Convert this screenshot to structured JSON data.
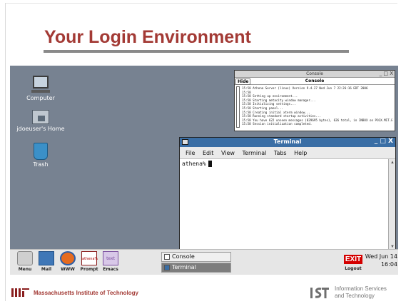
{
  "slide": {
    "title": "Your Login Environment"
  },
  "desktop": {
    "icons": [
      {
        "label": "Computer",
        "icon": "computer-icon"
      },
      {
        "label": "jdoeuser's Home",
        "icon": "home-folder-icon"
      },
      {
        "label": "Trash",
        "icon": "trash-icon"
      }
    ]
  },
  "console_window": {
    "title": "Console",
    "hide_label": "Hide",
    "header": "Console",
    "controls": "_ □ X",
    "lines": [
      "15:58 Athena Server (linux) Version 9.4.27 Wed Jun 7 22:26:16 EDT 2006",
      "15:58",
      "15:58 Setting up environment...",
      "15:58 Starting metacity window manager...",
      "15:58 Initializing settings...",
      "15:58 Starting panel...",
      "15:58 Creating initial xterm window...",
      "15:58 Running standard startup activities...",
      "15:58 You have 622 unseen messages (829695 bytes), 626 total, in INBOX on PO1X.MIT.EDU.",
      "15:58 Session initialization completed."
    ]
  },
  "terminal_window": {
    "title": "Terminal",
    "controls": "_ □ X",
    "menu": [
      "File",
      "Edit",
      "View",
      "Terminal",
      "Tabs",
      "Help"
    ],
    "prompt": "athena%"
  },
  "panel": {
    "launchers": [
      {
        "label": "Menu",
        "icon": "menu-icon"
      },
      {
        "label": "Mail",
        "icon": "mail-icon"
      },
      {
        "label": "WWW",
        "icon": "firefox-icon"
      },
      {
        "label": "Prompt",
        "icon": "prompt-icon",
        "icon_text": "athena%"
      },
      {
        "label": "Emacs",
        "icon": "emacs-icon",
        "icon_text": "text"
      }
    ],
    "tasks": [
      {
        "label": "Console",
        "active": false
      },
      {
        "label": "Terminal",
        "active": true
      }
    ],
    "exit_label": "EXIT",
    "logout_label": "Logout",
    "clock_date": "Wed Jun 14",
    "clock_time": "16:04"
  },
  "footer": {
    "institution": "Massachusetts Institute of Technology",
    "ist_line1": "Information Services",
    "ist_line2": "and Technology"
  },
  "colors": {
    "title": "#a33a35",
    "desktop_bg": "#778291",
    "terminal_titlebar": "#3a6ea5",
    "exit_red": "#d40000"
  }
}
